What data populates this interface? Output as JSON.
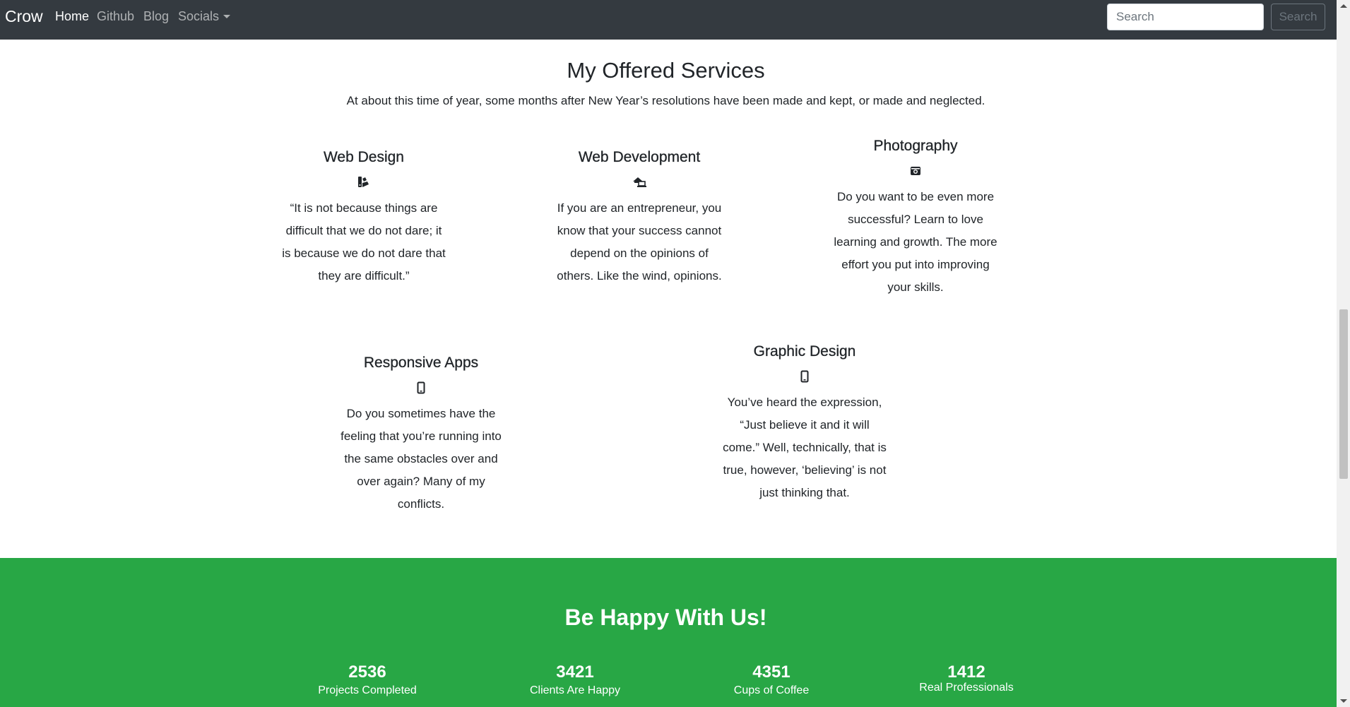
{
  "navbar": {
    "brand": "Crow",
    "links": [
      "Home",
      "Github",
      "Blog",
      "Socials"
    ],
    "search_placeholder": "Search",
    "search_button": "Search"
  },
  "services": {
    "title": "My Offered Services",
    "subtitle": "At about this time of year, some months after New Year’s resolutions have been made and kept, or made and neglected.",
    "items": [
      {
        "title": "Web Design",
        "icon": "palette-icon",
        "text": "“It is not because things are difficult that we do not dare; it is because we do not dare that they are difficult.”"
      },
      {
        "title": "Web Development",
        "icon": "laptop-house-icon",
        "text": "If you are an entrepreneur, you know that your success cannot depend on the opinions of others. Like the wind, opinions."
      },
      {
        "title": "Photography",
        "icon": "camera-retro-icon",
        "text": "Do you want to be even more successful? Learn to love learning and growth. The more effort you put into improving your skills."
      },
      {
        "title": "Responsive Apps",
        "icon": "mobile-icon",
        "text": "Do you sometimes have the feeling that you’re running into the same obstacles over and over again? Many of my conflicts."
      },
      {
        "title": "Graphic Design",
        "icon": "mobile-icon",
        "text": "You’ve heard the expression, “Just believe it and it will come.” Well, technically, that is true, however, ‘believing’ is not just thinking that."
      }
    ]
  },
  "happy": {
    "title": "Be Happy With Us!",
    "stats": [
      {
        "number": "2536",
        "label": "Projects Completed"
      },
      {
        "number": "3421",
        "label": "Clients Are Happy"
      },
      {
        "number": "4351",
        "label": "Cups of Coffee"
      },
      {
        "number": "1412",
        "label": "Real Professionals"
      }
    ]
  },
  "colors": {
    "navbar_bg": "#343a40",
    "green_section": "#28a745"
  }
}
